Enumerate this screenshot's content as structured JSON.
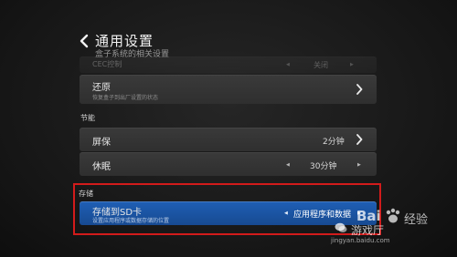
{
  "header": {
    "title": "通用设置",
    "subtitle": "盒子系统的相关设置"
  },
  "cec_row": {
    "label": "CEC控制",
    "value": "关闭"
  },
  "restore_row": {
    "label": "还原",
    "desc": "恢复盒子到出厂设置的状态"
  },
  "sections": {
    "energy": "节能",
    "storage": "存储"
  },
  "screensaver_row": {
    "label": "屏保",
    "value": "2分钟"
  },
  "sleep_row": {
    "label": "休眠",
    "value": "30分钟"
  },
  "storage_row": {
    "label": "存储到SD卡",
    "desc": "设置应用程序或数据存储的位置",
    "value": "应用程序和数据"
  },
  "watermark": {
    "brand": "Bai",
    "brand2": "经验",
    "wechat_text": "游戏厅",
    "url": "jingyan.baidu.com"
  },
  "colors": {
    "accent_selected": "#1f5fb5",
    "highlight_border": "#d21b1b"
  }
}
